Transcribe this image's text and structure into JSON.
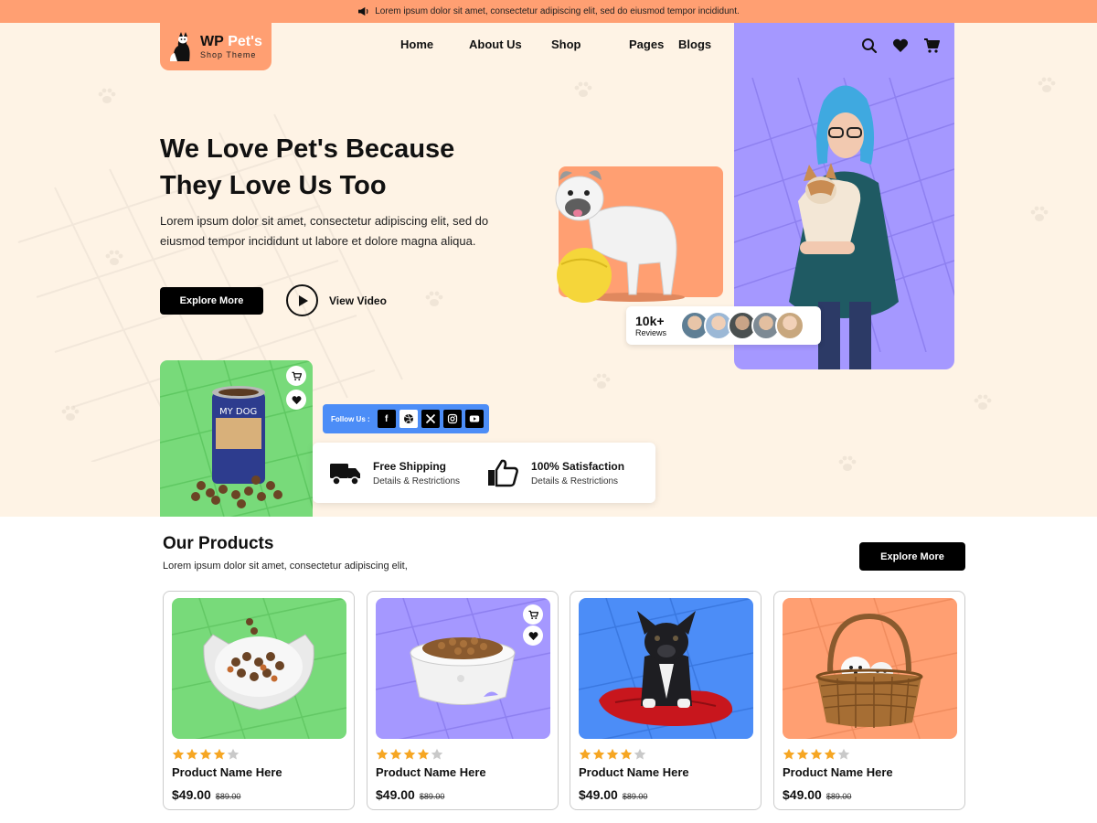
{
  "announcement": {
    "text": "Lorem ipsum dolor sit amet, consectetur adipiscing elit, sed do eiusmod tempor incididunt.",
    "icon": "megaphone-icon"
  },
  "logo": {
    "brand_prefix": "WP",
    "brand_name": "Pet's",
    "tagline": "Shop Theme"
  },
  "nav": {
    "items": [
      "Home",
      "About Us",
      "Shop",
      "Pages",
      "Blogs"
    ]
  },
  "header_icons": [
    "search-icon",
    "heart-icon",
    "cart-icon"
  ],
  "hero": {
    "title_line1": "We Love Pet's Because",
    "title_line2": "They Love Us Too",
    "description": "Lorem ipsum dolor sit amet, consectetur adipiscing elit, sed do eiusmod tempor incididunt ut labore et dolore magna aliqua.",
    "cta_label": "Explore More",
    "video_label": "View Video"
  },
  "reviews": {
    "count": "10k+",
    "label": "Reviews"
  },
  "follow": {
    "label": "Follow Us :",
    "networks": [
      "facebook",
      "dribbble",
      "x",
      "instagram",
      "youtube"
    ]
  },
  "features": [
    {
      "title": "Free Shipping",
      "subtitle": "Details & Restrictions",
      "icon": "truck-icon"
    },
    {
      "title": "100% Satisfaction",
      "subtitle": "Details & Restrictions",
      "icon": "thumbs-up-icon"
    }
  ],
  "products_section": {
    "title": "Our Products",
    "description": "Lorem ipsum dolor sit amet, consectetur adipiscing elit,",
    "cta_label": "Explore More"
  },
  "products": [
    {
      "name": "Product Name Here",
      "price": "$49.00",
      "old_price": "$89.00",
      "rating": 4,
      "bg": "#78DA7A",
      "image": "cat-food-bowl"
    },
    {
      "name": "Product Name Here",
      "price": "$49.00",
      "old_price": "$89.00",
      "rating": 4,
      "bg": "#A598FF",
      "image": "white-food-bowl"
    },
    {
      "name": "Product Name Here",
      "price": "$49.00",
      "old_price": "$89.00",
      "rating": 4,
      "bg": "#4C8DF7",
      "image": "french-bulldog-on-cushion"
    },
    {
      "name": "Product Name Here",
      "price": "$49.00",
      "old_price": "$89.00",
      "rating": 4,
      "bg": "#FF9F72",
      "image": "puppies-in-basket"
    }
  ],
  "colors": {
    "accent_orange": "#FF9F72",
    "hero_bg": "#FEF3E5",
    "purple": "#A598FF",
    "green": "#78DA7A",
    "blue": "#4C8DF7",
    "star": "#F6A623"
  }
}
